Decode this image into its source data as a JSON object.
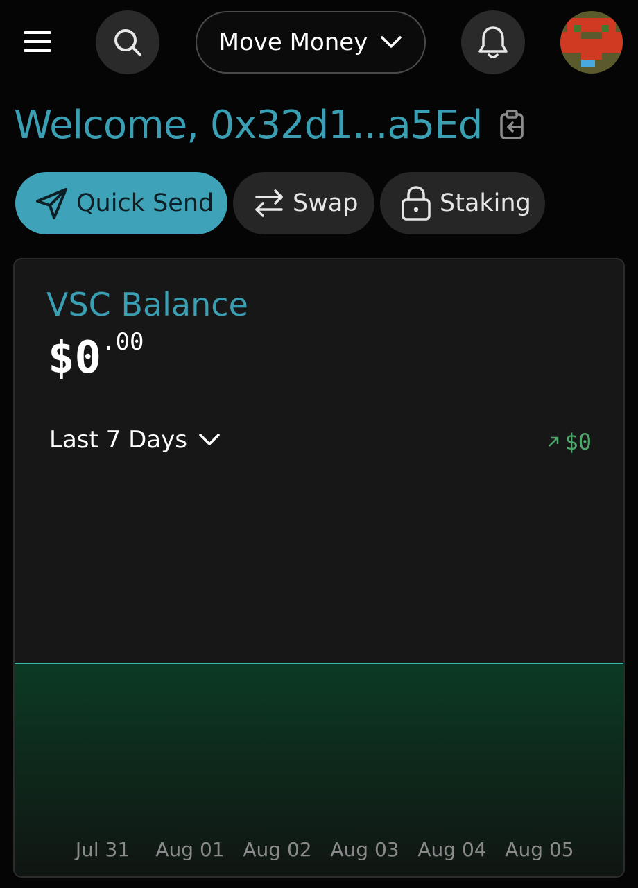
{
  "header": {
    "menu_icon": "hamburger-menu-icon",
    "search_icon": "search-icon",
    "move_money_label": "Move Money",
    "bell_icon": "bell-icon",
    "avatar": "pixel-avatar"
  },
  "welcome": {
    "text": "Welcome, 0x32d1...a5Ed",
    "copy_icon": "clipboard-copy-icon"
  },
  "actions": [
    {
      "label": "Quick Send",
      "icon": "send-icon",
      "active": true
    },
    {
      "label": "Swap",
      "icon": "swap-arrows-icon",
      "active": false
    },
    {
      "label": "Staking",
      "icon": "lock-icon",
      "active": false
    }
  ],
  "balance_card": {
    "title": "VSC Balance",
    "balance_main": "$0",
    "balance_cents": ".00",
    "range_label": "Last 7 Days",
    "change_value": "$0",
    "change_color": "#4fa86b"
  },
  "colors": {
    "accent": "#3b9fb3",
    "background": "#050505",
    "card": "#171717",
    "area_fill": "#0c3a24"
  },
  "chart_data": {
    "type": "area",
    "x": [
      "Jul 31",
      "Aug 01",
      "Aug 02",
      "Aug 03",
      "Aug 04",
      "Aug 05"
    ],
    "series": [
      {
        "values": [
          0,
          0,
          0,
          0,
          0,
          0
        ]
      }
    ],
    "grid": false
  }
}
